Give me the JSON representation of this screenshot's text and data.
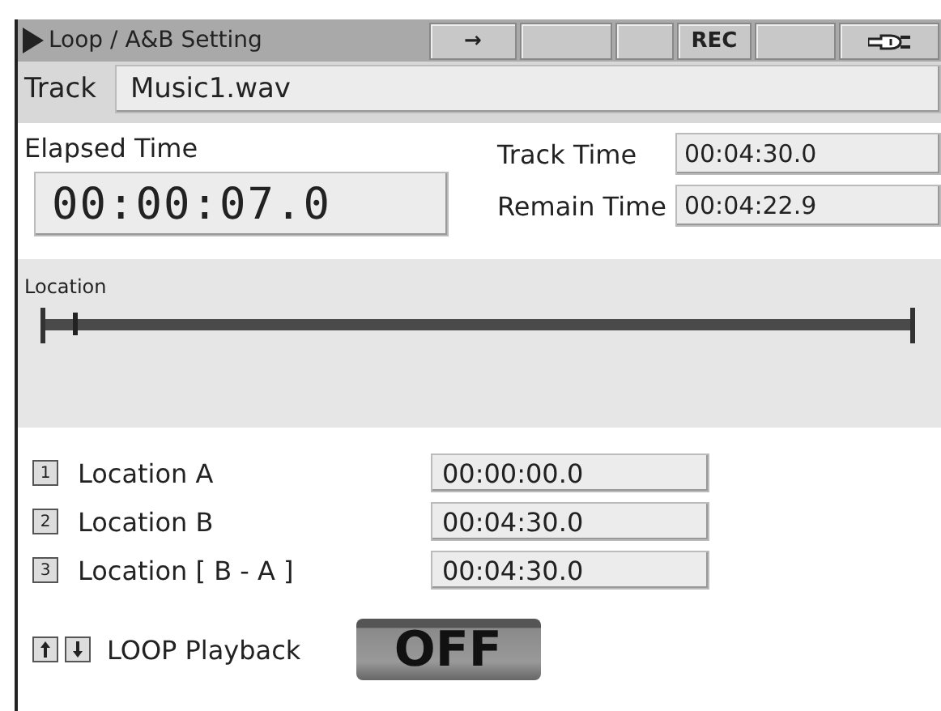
{
  "window": {
    "title": "Loop / A&B Setting"
  },
  "status_cells": [
    {
      "kind": "text",
      "text": "→"
    },
    {
      "kind": "blank"
    },
    {
      "kind": "blank"
    },
    {
      "kind": "text",
      "text": "REC"
    },
    {
      "kind": "blank"
    },
    {
      "kind": "plug"
    }
  ],
  "track": {
    "label": "Track",
    "value": "Music1.wav"
  },
  "elapsed": {
    "label": "Elapsed Time",
    "value": "00:00:07.0"
  },
  "times": [
    {
      "label": "Track Time",
      "value": "00:04:30.0"
    },
    {
      "label": "Remain Time",
      "value": "00:04:22.9"
    }
  ],
  "location": {
    "label": "Location",
    "level": 0.026
  },
  "locations": [
    {
      "key": "1",
      "label": "Location A",
      "value": "00:00:00.0"
    },
    {
      "key": "2",
      "label": "Location B",
      "value": "00:04:30.0"
    },
    {
      "key": "3",
      "label": "Location [ B - A ]",
      "value": "00:04:30.0"
    }
  ],
  "loop": {
    "label": "LOOP Playback",
    "button": "OFF",
    "on": false
  }
}
